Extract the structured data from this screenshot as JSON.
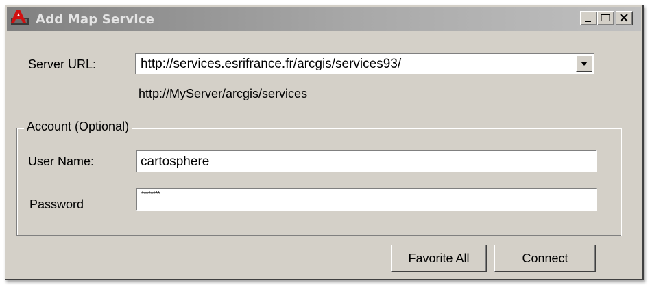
{
  "window": {
    "title": "Add Map Service",
    "icon": "autocad-app-icon",
    "controls": {
      "minimize": "minimize-icon",
      "maximize": "maximize-icon",
      "close": "close-icon"
    }
  },
  "server": {
    "label": "Server URL:",
    "value": "http://services.esrifrance.fr/arcgis/services93/",
    "hint": "http://MyServer/arcgis/services"
  },
  "account": {
    "legend": "Account (Optional)",
    "username_label": "User Name:",
    "username_value": "cartosphere",
    "password_label": "Password",
    "password_value": "********"
  },
  "buttons": {
    "favorite_all": "Favorite All",
    "connect": "Connect"
  },
  "colors": {
    "dialog_background": "#d4d0c8",
    "titlebar_inactive": "#a0a0a0",
    "icon_red": "#d01010"
  }
}
